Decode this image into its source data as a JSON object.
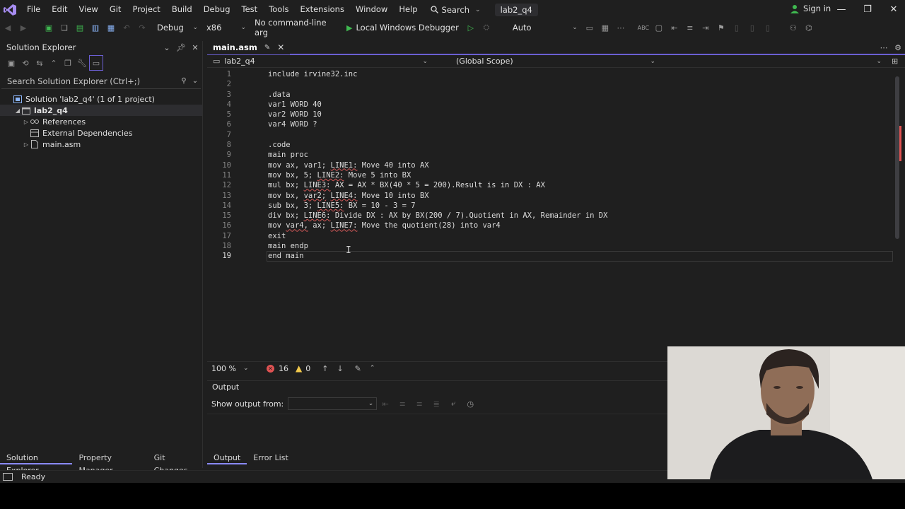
{
  "menu": {
    "items": [
      "File",
      "Edit",
      "View",
      "Git",
      "Project",
      "Build",
      "Debug",
      "Test",
      "Tools",
      "Extensions",
      "Window",
      "Help"
    ],
    "search_label": "Search",
    "project_title": "lab2_q4",
    "signin_label": "Sign in"
  },
  "toolbar": {
    "configuration": "Debug",
    "platform": "x86",
    "args_placeholder": "No command-line arg",
    "run_label": "Local Windows Debugger",
    "auto_label": "Auto"
  },
  "solution_explorer": {
    "title": "Solution Explorer",
    "search_placeholder": "Search Solution Explorer (Ctrl+;)",
    "tree": [
      {
        "label": "Solution 'lab2_q4' (1 of 1 project)",
        "level": 0,
        "expander": "",
        "icon": "solution-icon"
      },
      {
        "label": "lab2_q4",
        "level": 1,
        "expander": "◢",
        "icon": "project-icon",
        "selected": true,
        "bold": true
      },
      {
        "label": "References",
        "level": 2,
        "expander": "▷",
        "icon": "references-icon"
      },
      {
        "label": "External Dependencies",
        "level": 2,
        "expander": "",
        "icon": "external-deps-icon"
      },
      {
        "label": "main.asm",
        "level": 2,
        "expander": "▷",
        "icon": "file-icon"
      }
    ],
    "bottom_tabs": [
      "Solution Explorer",
      "Property Manager",
      "Git Changes"
    ]
  },
  "editor": {
    "tab_label": "main.asm",
    "nav_project": "lab2_q4",
    "nav_scope": "(Global Scope)",
    "zoom": "100 %",
    "error_count": "16",
    "warning_count": "0",
    "lines": [
      {
        "n": "1",
        "text": "include irvine32.inc",
        "squiggles": []
      },
      {
        "n": "2",
        "text": "",
        "squiggles": []
      },
      {
        "n": "3",
        "text": ".data",
        "squiggles": []
      },
      {
        "n": "4",
        "text": "var1 WORD 40",
        "squiggles": []
      },
      {
        "n": "5",
        "text": "var2 WORD 10",
        "squiggles": []
      },
      {
        "n": "6",
        "text": "var4 WORD ?",
        "squiggles": []
      },
      {
        "n": "7",
        "text": "",
        "squiggles": []
      },
      {
        "n": "8",
        "text": ".code",
        "squiggles": []
      },
      {
        "n": "9",
        "text": "main proc",
        "squiggles": []
      },
      {
        "n": "10",
        "text": "mov ax, var1; LINE1: Move 40 into AX",
        "squiggles": [
          "LINE1:"
        ]
      },
      {
        "n": "11",
        "text": "mov bx, 5; LINE2: Move 5 into BX",
        "squiggles": [
          "LINE2:"
        ]
      },
      {
        "n": "12",
        "text": "mul bx; LINE3: AX = AX * BX(40 * 5 = 200).Result is in DX : AX",
        "squiggles": [
          "LINE3:"
        ]
      },
      {
        "n": "13",
        "text": "mov bx, var2; LINE4: Move 10 into BX",
        "squiggles": [
          "var2;",
          "LINE4:"
        ]
      },
      {
        "n": "14",
        "text": "sub bx, 3; LINE5: BX = 10 - 3 = 7",
        "squiggles": [
          "LINE5:"
        ]
      },
      {
        "n": "15",
        "text": "div bx; LINE6: Divide DX : AX by BX(200 / 7).Quotient in AX, Remainder in DX",
        "squiggles": [
          "LINE6:"
        ]
      },
      {
        "n": "16",
        "text": "mov var4, ax; LINE7: Move the quotient(28) into var4",
        "squiggles": [
          "var4,",
          "LINE7:"
        ]
      },
      {
        "n": "17",
        "text": "exit",
        "squiggles": []
      },
      {
        "n": "18",
        "text": "main endp",
        "squiggles": []
      },
      {
        "n": "19",
        "text": "end main",
        "squiggles": [],
        "current": true
      }
    ]
  },
  "output": {
    "title": "Output",
    "show_from_label": "Show output from:",
    "source_value": "",
    "bottom_tabs": [
      "Output",
      "Error List"
    ]
  },
  "status": {
    "text": "Ready"
  },
  "colors": {
    "accent": "#6b5fd3",
    "error": "#e05252",
    "warning": "#f2c94c",
    "run": "#3fb950"
  }
}
